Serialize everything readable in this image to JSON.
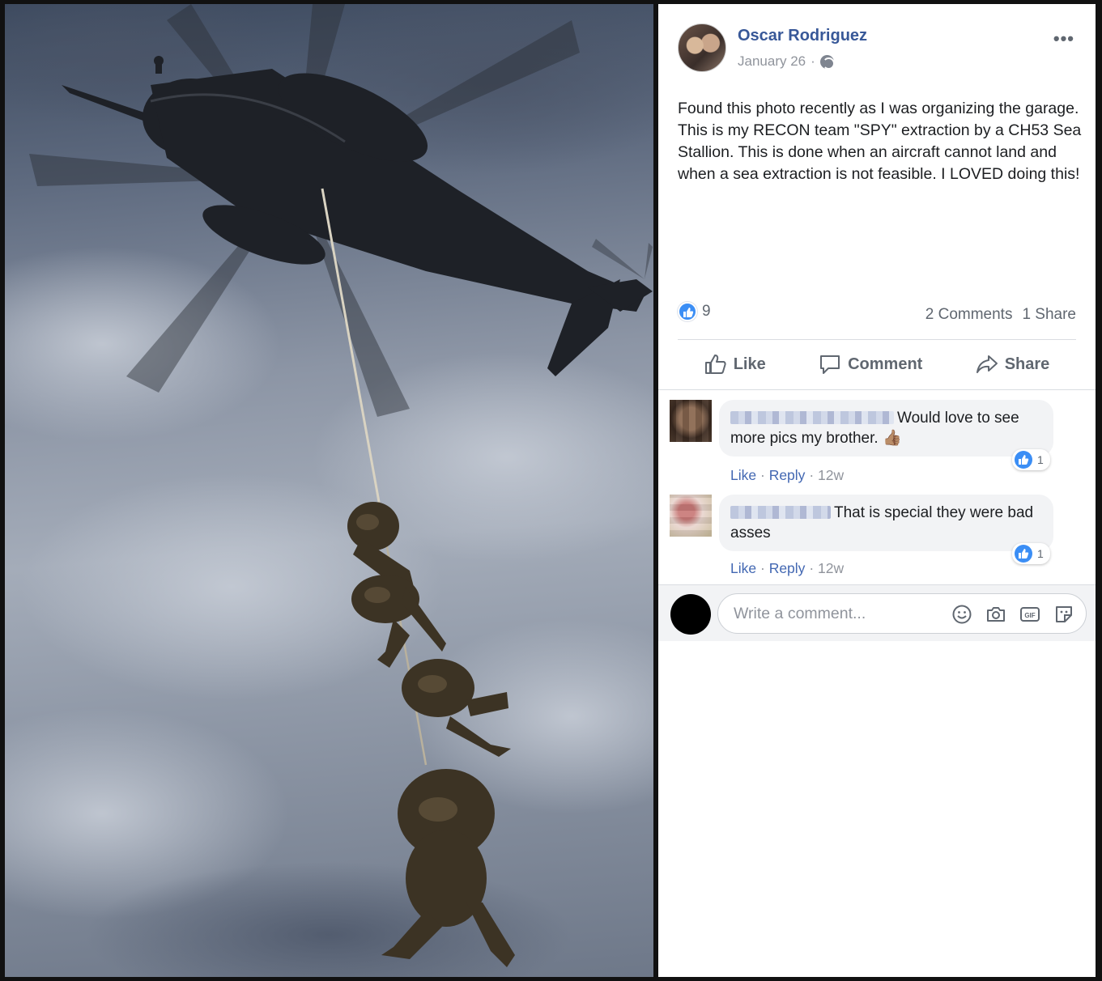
{
  "post": {
    "author": "Oscar Rodriguez",
    "date": "January 26",
    "date_separator": "·",
    "more_label": "•••",
    "text": "Found this photo recently as I was organizing the garage. This is my RECON team \"SPY\" extraction by a CH53 Sea Stallion. This is done when an aircraft cannot land and when a sea extraction is not feasible. I LOVED doing this!",
    "reaction_count": "9",
    "comments_count": "2 Comments",
    "shares_count": "1 Share",
    "reaction_icon": "like-icon",
    "privacy_icon": "globe-icon"
  },
  "actions": {
    "like": "Like",
    "comment": "Comment",
    "share": "Share"
  },
  "comments": [
    {
      "text": "Would love to see more pics my brother. 👍🏽",
      "like_label": "Like",
      "reply_label": "Reply",
      "time": "12w",
      "reaction_count": "1"
    },
    {
      "text": "That is special they were bad asses",
      "like_label": "Like",
      "reply_label": "Reply",
      "time": "12w",
      "reaction_count": "1"
    }
  ],
  "composer": {
    "placeholder": "Write a comment...",
    "icons": [
      "emoji-icon",
      "camera-icon",
      "gif-icon",
      "sticker-icon"
    ]
  },
  "colors": {
    "author_blue": "#385898",
    "link_blue": "#4267b2",
    "like_blue": "#3b8ef5",
    "muted_text": "#606770"
  }
}
